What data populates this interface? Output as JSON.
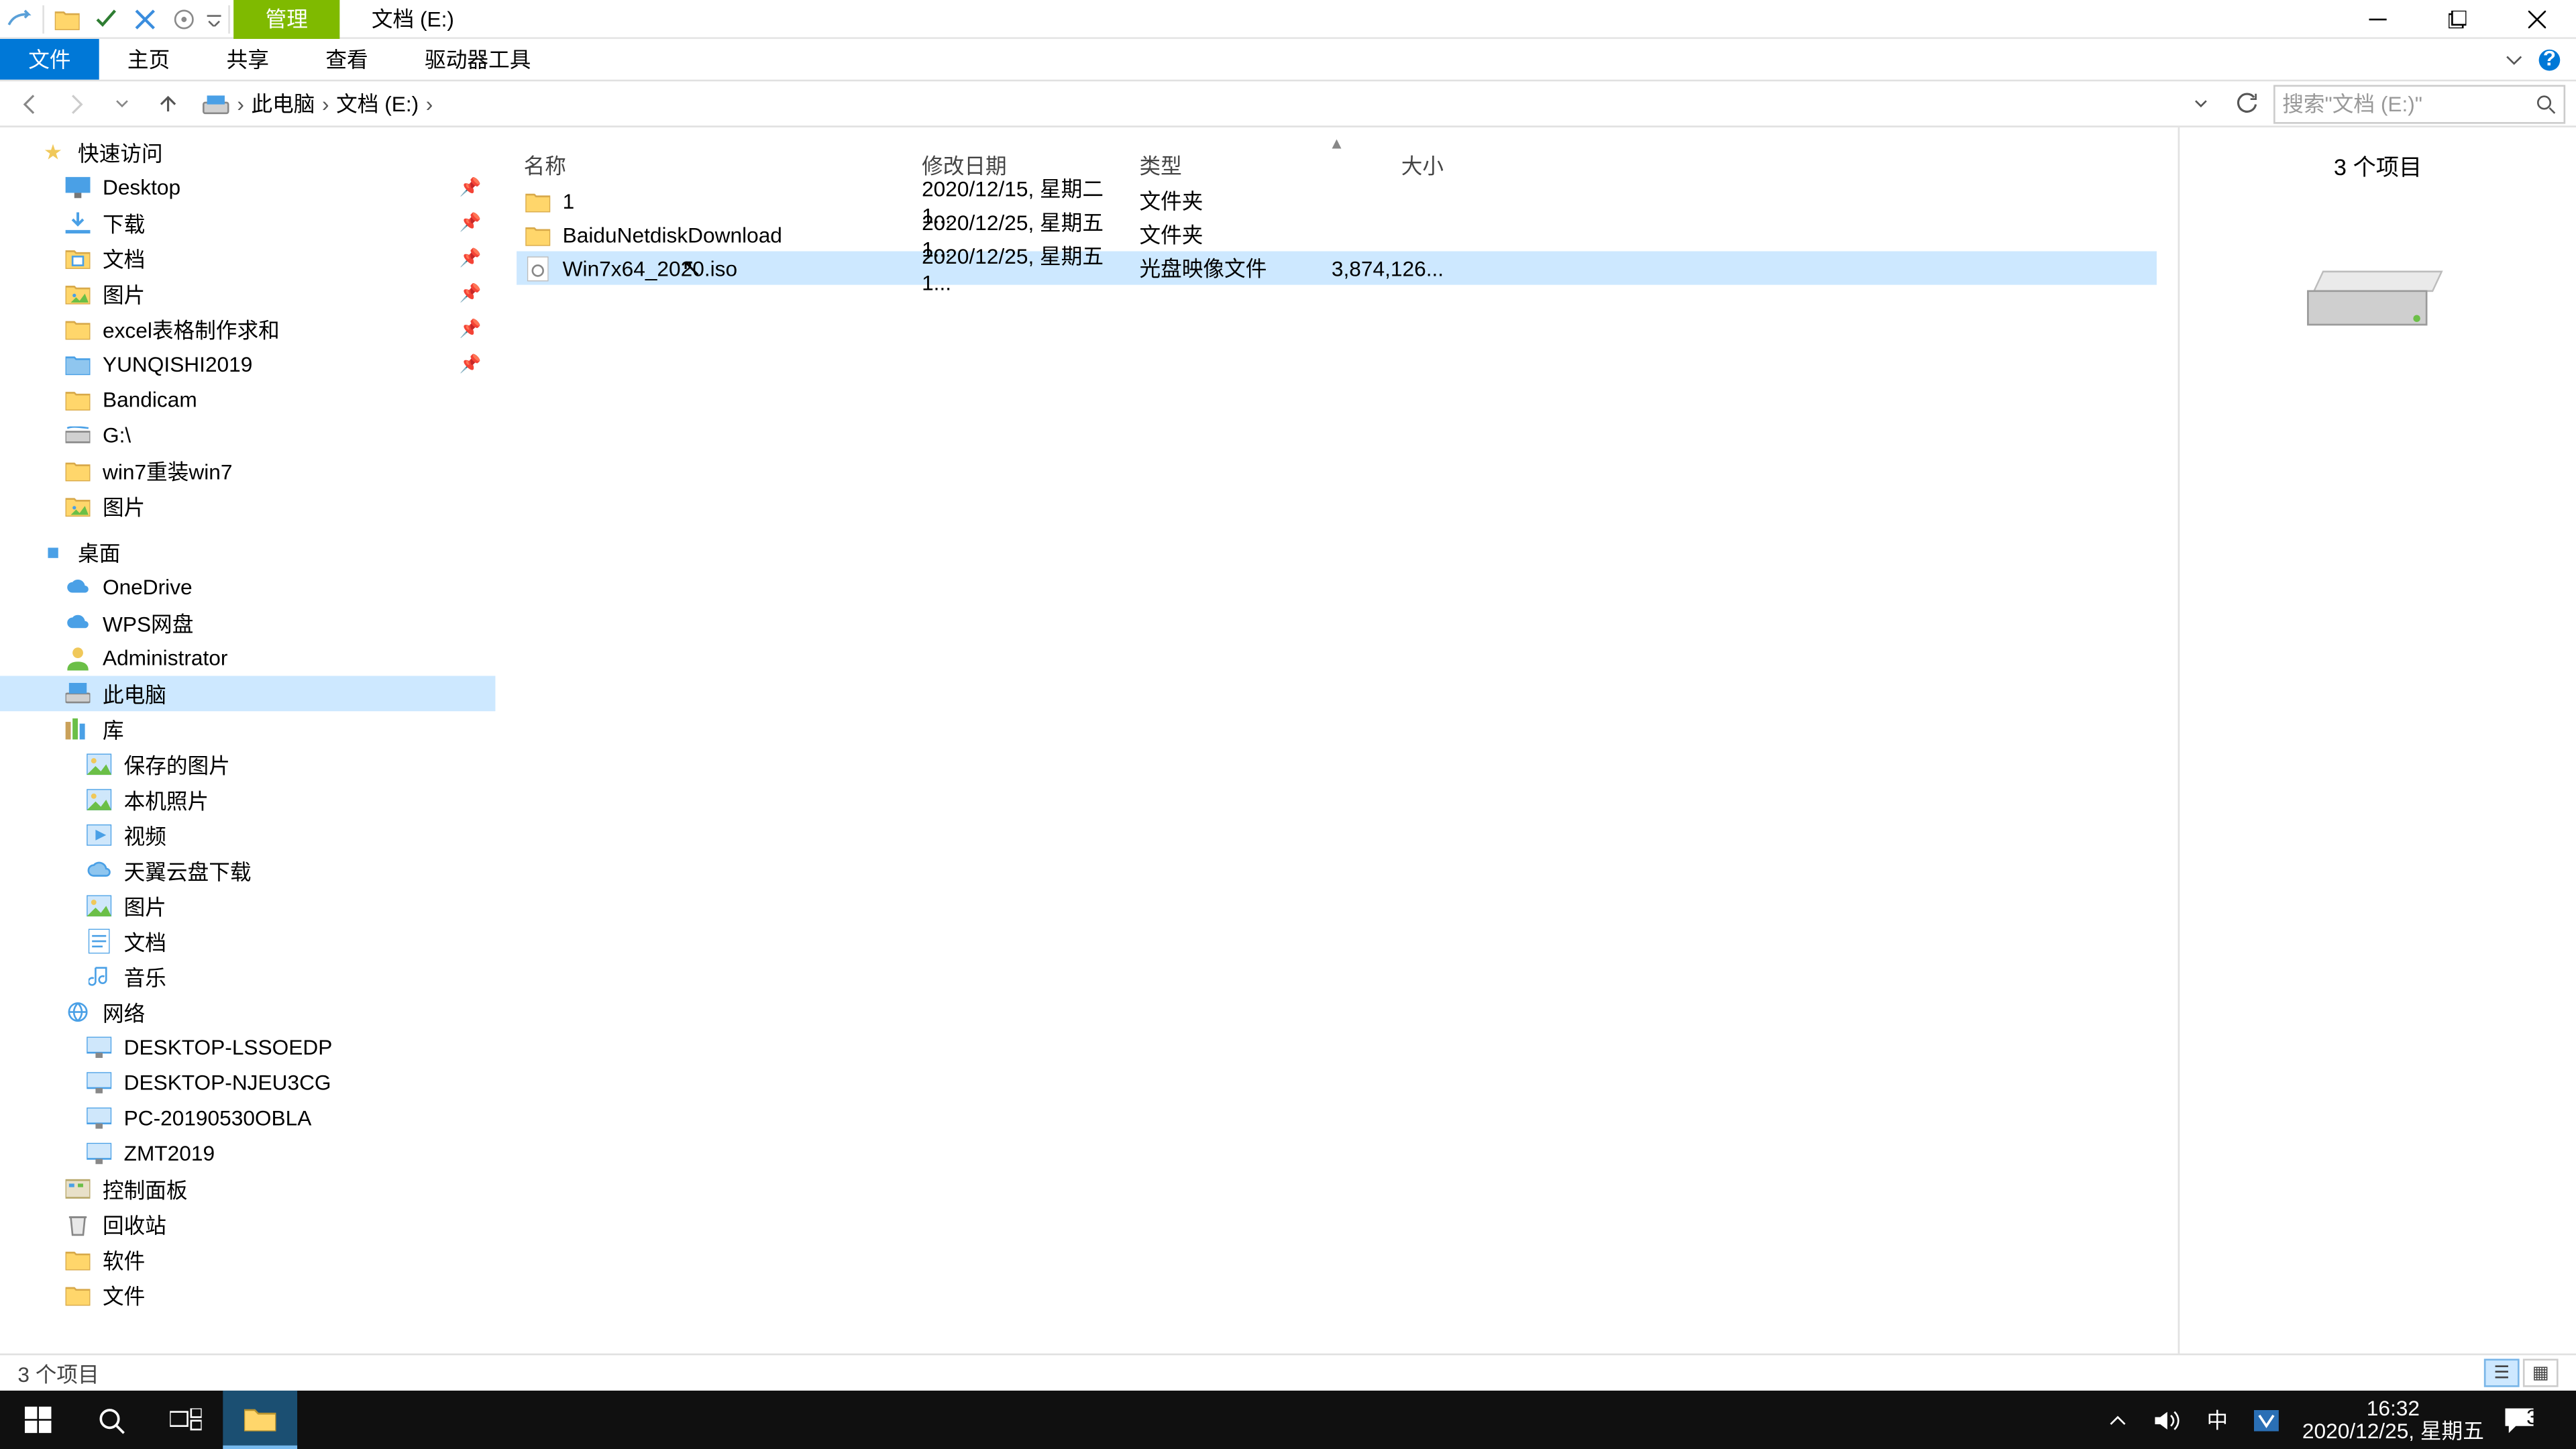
{
  "title": {
    "manage_tab": "管理",
    "location": "文档 (E:)"
  },
  "ribbon": {
    "file": "文件",
    "home": "主页",
    "share": "共享",
    "view": "查看",
    "drive_tools": "驱动器工具"
  },
  "breadcrumb": {
    "this_pc": "此电脑",
    "current": "文档 (E:)"
  },
  "search": {
    "placeholder": "搜索\"文档 (E:)\""
  },
  "columns": {
    "name": "名称",
    "date": "修改日期",
    "type": "类型",
    "size": "大小"
  },
  "rows": [
    {
      "name": "1",
      "date": "2020/12/15, 星期二 1...",
      "type": "文件夹",
      "size": "",
      "icon": "folder"
    },
    {
      "name": "BaiduNetdiskDownload",
      "date": "2020/12/25, 星期五 1...",
      "type": "文件夹",
      "size": "",
      "icon": "folder"
    },
    {
      "name": "Win7x64_2020.iso",
      "date": "2020/12/25, 星期五 1...",
      "type": "光盘映像文件",
      "size": "3,874,126...",
      "icon": "iso"
    }
  ],
  "tree": {
    "quick_access": "快速访问",
    "qa_items": [
      {
        "label": "Desktop",
        "icon": "desktop-blue",
        "pin": true
      },
      {
        "label": "下载",
        "icon": "download-blue",
        "pin": true
      },
      {
        "label": "文档",
        "icon": "doc-folder",
        "pin": true
      },
      {
        "label": "图片",
        "icon": "pic-folder",
        "pin": true
      },
      {
        "label": "excel表格制作求和",
        "icon": "folder",
        "pin": true
      },
      {
        "label": "YUNQISHI2019",
        "icon": "folder-blue",
        "pin": true
      },
      {
        "label": "Bandicam",
        "icon": "folder",
        "pin": false
      },
      {
        "label": "G:\\",
        "icon": "drive-blue",
        "pin": false
      },
      {
        "label": "win7重装win7",
        "icon": "folder",
        "pin": false
      },
      {
        "label": "图片",
        "icon": "pic-folder",
        "pin": false
      }
    ],
    "desktop": "桌面",
    "desktop_items": [
      {
        "label": "OneDrive",
        "icon": "cloud-blue"
      },
      {
        "label": "WPS网盘",
        "icon": "cloud-blue"
      },
      {
        "label": "Administrator",
        "icon": "user"
      },
      {
        "label": "此电脑",
        "icon": "pc",
        "selected": true
      },
      {
        "label": "库",
        "icon": "libraries"
      }
    ],
    "lib_items": [
      {
        "label": "保存的图片",
        "icon": "pic-lib"
      },
      {
        "label": "本机照片",
        "icon": "pic-lib"
      },
      {
        "label": "视频",
        "icon": "video-lib"
      },
      {
        "label": "天翼云盘下载",
        "icon": "cloud-lib"
      },
      {
        "label": "图片",
        "icon": "pic-lib"
      },
      {
        "label": "文档",
        "icon": "doc-lib"
      },
      {
        "label": "音乐",
        "icon": "music-lib"
      }
    ],
    "network": "网络",
    "net_items": [
      {
        "label": "DESKTOP-LSSOEDP"
      },
      {
        "label": "DESKTOP-NJEU3CG"
      },
      {
        "label": "PC-20190530OBLA"
      },
      {
        "label": "ZMT2019"
      }
    ],
    "ctrl_panel": "控制面板",
    "recycle": "回收站",
    "soft": "软件",
    "files_folder": "文件"
  },
  "preview": {
    "header": "3 个项目"
  },
  "status": {
    "text": "3 个项目"
  },
  "clock": {
    "time": "16:32",
    "date": "2020/12/25, 星期五"
  },
  "ime": "中"
}
